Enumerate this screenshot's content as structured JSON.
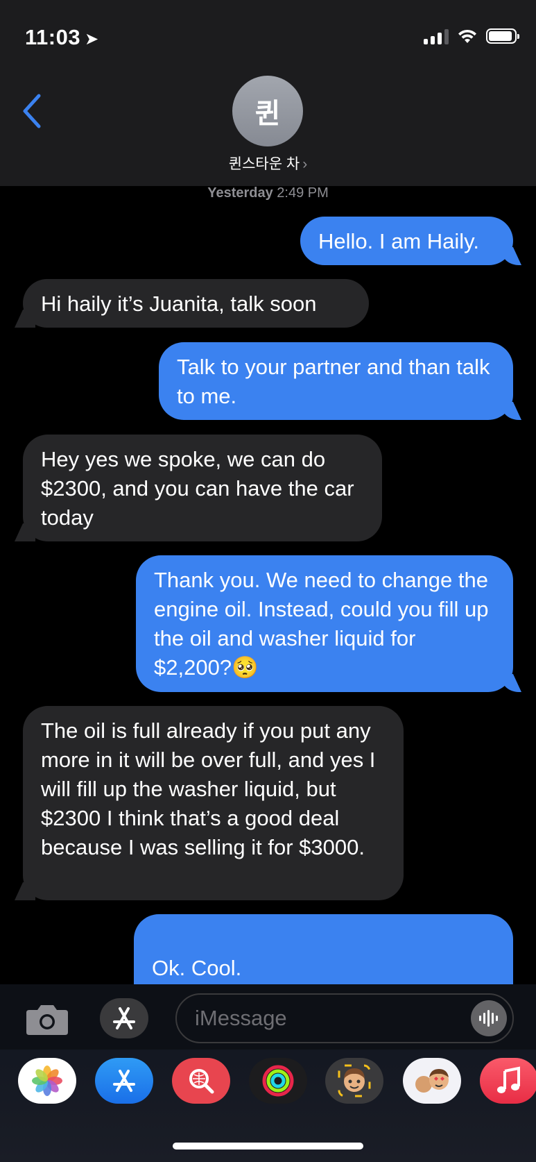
{
  "status_bar": {
    "time": "11:03"
  },
  "header": {
    "avatar_initial": "퀸",
    "contact_name": "퀸스타운 차",
    "chevron": "›"
  },
  "timestamp": {
    "day": "Yesterday",
    "time": "2:49 PM"
  },
  "messages": [
    {
      "direction": "sent",
      "text": "Hello. I am Haily."
    },
    {
      "direction": "received",
      "text": "Hi haily it’s Juanita, talk soon"
    },
    {
      "direction": "sent",
      "text": "Talk to your partner and than talk to me."
    },
    {
      "direction": "received",
      "text": "Hey yes we spoke, we can do $2300, and you can have the car today"
    },
    {
      "direction": "sent",
      "text": "Thank you. We need to change the engine oil. Instead, could you fill up the oil and washer liquid for $2,200?🥺"
    },
    {
      "direction": "received",
      "text": "The oil is full already if you put any more in it will be over full, and yes I will fill up the washer liquid, but $2300 I think that’s a good deal because I was selling it for $3000."
    },
    {
      "direction": "sent",
      "text": "Ok. Cool.\nIf you don't mind, the post"
    }
  ],
  "composer": {
    "placeholder": "iMessage",
    "icons": [
      "camera-icon",
      "app-store-icon",
      "audio-message-icon"
    ]
  },
  "app_tray": [
    "photos-icon",
    "app-store-icon",
    "images-search-icon",
    "activity-icon",
    "memoji-icon",
    "memoji-stickers-icon",
    "music-icon"
  ],
  "colors": {
    "sent_bubble": "#3b82f0",
    "received_bubble": "#262628",
    "accent": "#3b82f0"
  }
}
